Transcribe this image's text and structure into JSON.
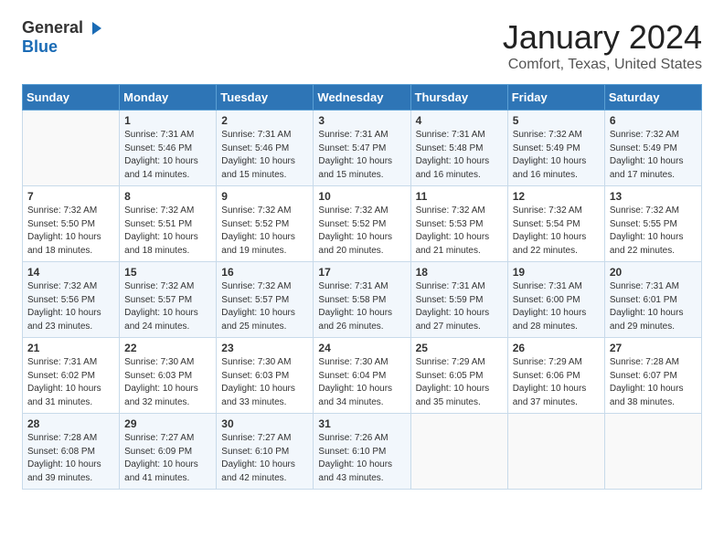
{
  "logo": {
    "general": "General",
    "blue": "Blue"
  },
  "header": {
    "month": "January 2024",
    "location": "Comfort, Texas, United States"
  },
  "weekdays": [
    "Sunday",
    "Monday",
    "Tuesday",
    "Wednesday",
    "Thursday",
    "Friday",
    "Saturday"
  ],
  "weeks": [
    [
      {
        "day": "",
        "sunrise": "",
        "sunset": "",
        "daylight": ""
      },
      {
        "day": "1",
        "sunrise": "Sunrise: 7:31 AM",
        "sunset": "Sunset: 5:46 PM",
        "daylight": "Daylight: 10 hours and 14 minutes."
      },
      {
        "day": "2",
        "sunrise": "Sunrise: 7:31 AM",
        "sunset": "Sunset: 5:46 PM",
        "daylight": "Daylight: 10 hours and 15 minutes."
      },
      {
        "day": "3",
        "sunrise": "Sunrise: 7:31 AM",
        "sunset": "Sunset: 5:47 PM",
        "daylight": "Daylight: 10 hours and 15 minutes."
      },
      {
        "day": "4",
        "sunrise": "Sunrise: 7:31 AM",
        "sunset": "Sunset: 5:48 PM",
        "daylight": "Daylight: 10 hours and 16 minutes."
      },
      {
        "day": "5",
        "sunrise": "Sunrise: 7:32 AM",
        "sunset": "Sunset: 5:49 PM",
        "daylight": "Daylight: 10 hours and 16 minutes."
      },
      {
        "day": "6",
        "sunrise": "Sunrise: 7:32 AM",
        "sunset": "Sunset: 5:49 PM",
        "daylight": "Daylight: 10 hours and 17 minutes."
      }
    ],
    [
      {
        "day": "7",
        "sunrise": "Sunrise: 7:32 AM",
        "sunset": "Sunset: 5:50 PM",
        "daylight": "Daylight: 10 hours and 18 minutes."
      },
      {
        "day": "8",
        "sunrise": "Sunrise: 7:32 AM",
        "sunset": "Sunset: 5:51 PM",
        "daylight": "Daylight: 10 hours and 18 minutes."
      },
      {
        "day": "9",
        "sunrise": "Sunrise: 7:32 AM",
        "sunset": "Sunset: 5:52 PM",
        "daylight": "Daylight: 10 hours and 19 minutes."
      },
      {
        "day": "10",
        "sunrise": "Sunrise: 7:32 AM",
        "sunset": "Sunset: 5:52 PM",
        "daylight": "Daylight: 10 hours and 20 minutes."
      },
      {
        "day": "11",
        "sunrise": "Sunrise: 7:32 AM",
        "sunset": "Sunset: 5:53 PM",
        "daylight": "Daylight: 10 hours and 21 minutes."
      },
      {
        "day": "12",
        "sunrise": "Sunrise: 7:32 AM",
        "sunset": "Sunset: 5:54 PM",
        "daylight": "Daylight: 10 hours and 22 minutes."
      },
      {
        "day": "13",
        "sunrise": "Sunrise: 7:32 AM",
        "sunset": "Sunset: 5:55 PM",
        "daylight": "Daylight: 10 hours and 22 minutes."
      }
    ],
    [
      {
        "day": "14",
        "sunrise": "Sunrise: 7:32 AM",
        "sunset": "Sunset: 5:56 PM",
        "daylight": "Daylight: 10 hours and 23 minutes."
      },
      {
        "day": "15",
        "sunrise": "Sunrise: 7:32 AM",
        "sunset": "Sunset: 5:57 PM",
        "daylight": "Daylight: 10 hours and 24 minutes."
      },
      {
        "day": "16",
        "sunrise": "Sunrise: 7:32 AM",
        "sunset": "Sunset: 5:57 PM",
        "daylight": "Daylight: 10 hours and 25 minutes."
      },
      {
        "day": "17",
        "sunrise": "Sunrise: 7:31 AM",
        "sunset": "Sunset: 5:58 PM",
        "daylight": "Daylight: 10 hours and 26 minutes."
      },
      {
        "day": "18",
        "sunrise": "Sunrise: 7:31 AM",
        "sunset": "Sunset: 5:59 PM",
        "daylight": "Daylight: 10 hours and 27 minutes."
      },
      {
        "day": "19",
        "sunrise": "Sunrise: 7:31 AM",
        "sunset": "Sunset: 6:00 PM",
        "daylight": "Daylight: 10 hours and 28 minutes."
      },
      {
        "day": "20",
        "sunrise": "Sunrise: 7:31 AM",
        "sunset": "Sunset: 6:01 PM",
        "daylight": "Daylight: 10 hours and 29 minutes."
      }
    ],
    [
      {
        "day": "21",
        "sunrise": "Sunrise: 7:31 AM",
        "sunset": "Sunset: 6:02 PM",
        "daylight": "Daylight: 10 hours and 31 minutes."
      },
      {
        "day": "22",
        "sunrise": "Sunrise: 7:30 AM",
        "sunset": "Sunset: 6:03 PM",
        "daylight": "Daylight: 10 hours and 32 minutes."
      },
      {
        "day": "23",
        "sunrise": "Sunrise: 7:30 AM",
        "sunset": "Sunset: 6:03 PM",
        "daylight": "Daylight: 10 hours and 33 minutes."
      },
      {
        "day": "24",
        "sunrise": "Sunrise: 7:30 AM",
        "sunset": "Sunset: 6:04 PM",
        "daylight": "Daylight: 10 hours and 34 minutes."
      },
      {
        "day": "25",
        "sunrise": "Sunrise: 7:29 AM",
        "sunset": "Sunset: 6:05 PM",
        "daylight": "Daylight: 10 hours and 35 minutes."
      },
      {
        "day": "26",
        "sunrise": "Sunrise: 7:29 AM",
        "sunset": "Sunset: 6:06 PM",
        "daylight": "Daylight: 10 hours and 37 minutes."
      },
      {
        "day": "27",
        "sunrise": "Sunrise: 7:28 AM",
        "sunset": "Sunset: 6:07 PM",
        "daylight": "Daylight: 10 hours and 38 minutes."
      }
    ],
    [
      {
        "day": "28",
        "sunrise": "Sunrise: 7:28 AM",
        "sunset": "Sunset: 6:08 PM",
        "daylight": "Daylight: 10 hours and 39 minutes."
      },
      {
        "day": "29",
        "sunrise": "Sunrise: 7:27 AM",
        "sunset": "Sunset: 6:09 PM",
        "daylight": "Daylight: 10 hours and 41 minutes."
      },
      {
        "day": "30",
        "sunrise": "Sunrise: 7:27 AM",
        "sunset": "Sunset: 6:10 PM",
        "daylight": "Daylight: 10 hours and 42 minutes."
      },
      {
        "day": "31",
        "sunrise": "Sunrise: 7:26 AM",
        "sunset": "Sunset: 6:10 PM",
        "daylight": "Daylight: 10 hours and 43 minutes."
      },
      {
        "day": "",
        "sunrise": "",
        "sunset": "",
        "daylight": ""
      },
      {
        "day": "",
        "sunrise": "",
        "sunset": "",
        "daylight": ""
      },
      {
        "day": "",
        "sunrise": "",
        "sunset": "",
        "daylight": ""
      }
    ]
  ]
}
